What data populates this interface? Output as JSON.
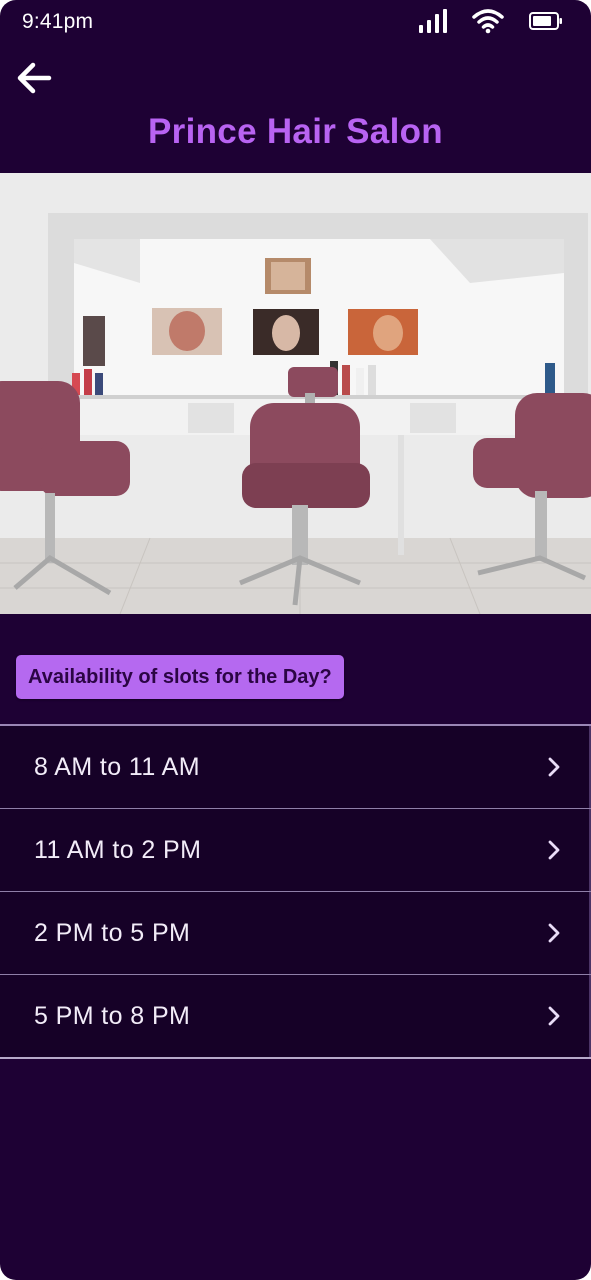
{
  "status_bar": {
    "time": "9:41pm",
    "icons": [
      "signal-icon",
      "wifi-icon",
      "battery-icon"
    ]
  },
  "header": {
    "back_icon": "arrow-left-icon",
    "title": "Prince Hair Salon"
  },
  "hero_image": {
    "subject": "salon-interior"
  },
  "availability": {
    "label": "Availability of slots for the Day?"
  },
  "slots": [
    {
      "label": "8 AM to 11 AM",
      "icon": "chevron-right-icon"
    },
    {
      "label": "11 AM to 2 PM",
      "icon": "chevron-right-icon"
    },
    {
      "label": "2 PM to 5 PM",
      "icon": "chevron-right-icon"
    },
    {
      "label": "5 PM to 8 PM",
      "icon": "chevron-right-icon"
    }
  ],
  "colors": {
    "background": "#1e0134",
    "title": "#b863f2",
    "badge_background": "#b569f0",
    "list_background": "#160127"
  }
}
